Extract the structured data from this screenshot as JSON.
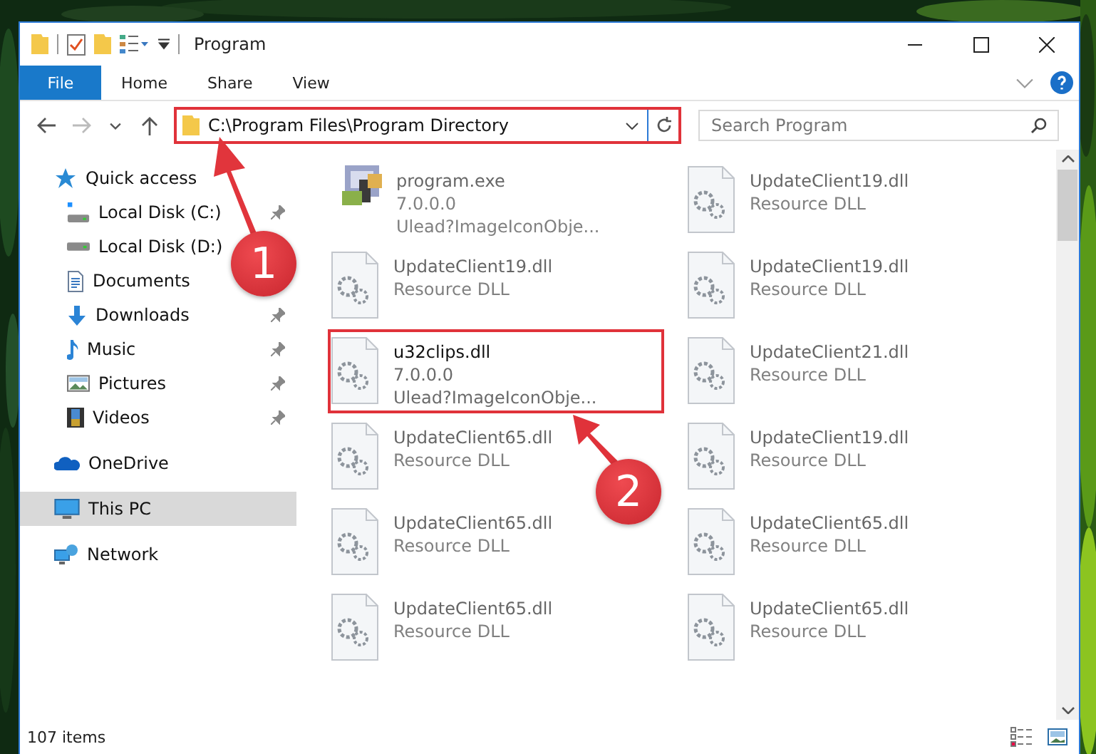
{
  "window": {
    "title": "Program"
  },
  "ribbon": {
    "tabs": [
      {
        "label": "File",
        "selected": true
      },
      {
        "label": "Home",
        "selected": false
      },
      {
        "label": "Share",
        "selected": false
      },
      {
        "label": "View",
        "selected": false
      }
    ]
  },
  "address": {
    "path": "C:\\Program Files\\Program Directory",
    "highlighted": true
  },
  "search": {
    "placeholder": "Search Program"
  },
  "sidebar": {
    "items": [
      {
        "label": "Quick access",
        "kind": "star",
        "selected": false,
        "children": [
          {
            "label": "Local Disk (C:)",
            "kind": "system-drive",
            "pinned": true
          },
          {
            "label": "Local Disk (D:)",
            "kind": "drive"
          },
          {
            "label": "Documents",
            "kind": "documents"
          },
          {
            "label": "Downloads",
            "kind": "downloads",
            "pinned": true
          },
          {
            "label": "Music",
            "kind": "music",
            "pinned": true
          },
          {
            "label": "Pictures",
            "kind": "pictures",
            "pinned": true
          },
          {
            "label": "Videos",
            "kind": "videos",
            "pinned": true
          }
        ]
      },
      {
        "label": "OneDrive",
        "kind": "cloud",
        "selected": false
      },
      {
        "label": "This PC",
        "kind": "computer",
        "selected": true
      },
      {
        "label": "Network",
        "kind": "network",
        "selected": false
      }
    ]
  },
  "files": [
    {
      "name": "program.exe",
      "kind": "exe",
      "details": [
        "7.0.0.0",
        "Ulead?ImageIconObje..."
      ],
      "faded": true,
      "highlighted": false
    },
    {
      "name": "UpdateClient19.dll",
      "kind": "dll",
      "details": [
        "Resource DLL"
      ],
      "faded": true,
      "highlighted": false
    },
    {
      "name": "UpdateClient19.dll",
      "kind": "dll",
      "details": [
        "Resource DLL"
      ],
      "faded": true,
      "highlighted": false
    },
    {
      "name": "UpdateClient19.dll",
      "kind": "dll",
      "details": [
        "Resource DLL"
      ],
      "faded": true,
      "highlighted": false
    },
    {
      "name": "u32clips.dll",
      "kind": "dll",
      "details": [
        "7.0.0.0",
        "Ulead?ImageIconObje..."
      ],
      "faded": false,
      "highlighted": true
    },
    {
      "name": "UpdateClient21.dll",
      "kind": "dll",
      "details": [
        "Resource DLL"
      ],
      "faded": true,
      "highlighted": false
    },
    {
      "name": "UpdateClient65.dll",
      "kind": "dll",
      "details": [
        "Resource DLL"
      ],
      "faded": true,
      "highlighted": false
    },
    {
      "name": "UpdateClient19.dll",
      "kind": "dll",
      "details": [
        "Resource DLL"
      ],
      "faded": true,
      "highlighted": false
    },
    {
      "name": "UpdateClient65.dll",
      "kind": "dll",
      "details": [
        "Resource DLL"
      ],
      "faded": true,
      "highlighted": false
    },
    {
      "name": "UpdateClient65.dll",
      "kind": "dll",
      "details": [
        "Resource DLL"
      ],
      "faded": true,
      "highlighted": false
    },
    {
      "name": "UpdateClient65.dll",
      "kind": "dll",
      "details": [
        "Resource DLL"
      ],
      "faded": true,
      "highlighted": false
    },
    {
      "name": "UpdateClient65.dll",
      "kind": "dll",
      "details": [
        "Resource DLL"
      ],
      "faded": true,
      "highlighted": false
    }
  ],
  "status_bar": {
    "count": "107 items"
  },
  "annotations": [
    {
      "number": "1"
    },
    {
      "number": "2"
    }
  ]
}
